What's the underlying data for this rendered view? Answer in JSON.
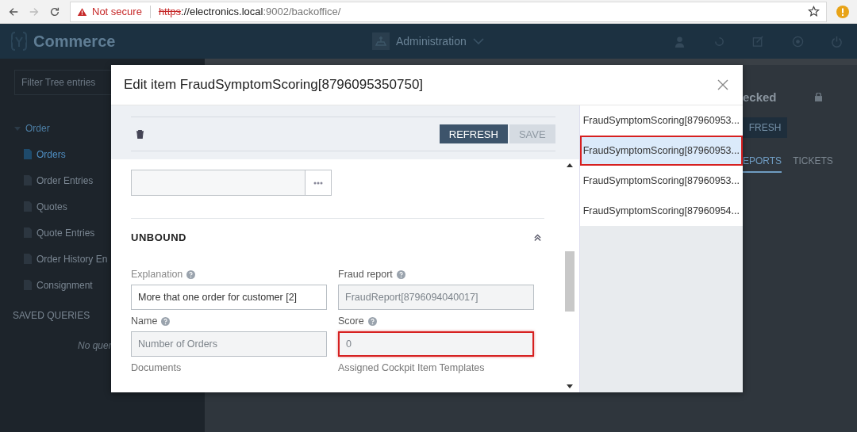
{
  "browser": {
    "security": "Not secure",
    "url_scheme": "https",
    "url_host": "://electronics.local",
    "url_rest": ":9002/backoffice/"
  },
  "header": {
    "logo": "Commerce",
    "perspective": "Administration"
  },
  "sidebar": {
    "filter_placeholder": "Filter Tree entries",
    "tree": [
      {
        "label": "Order",
        "expanded": true,
        "children": [
          {
            "label": "Orders",
            "selected": true
          },
          {
            "label": "Order Entries",
            "selected": false
          },
          {
            "label": "Quotes",
            "selected": false
          },
          {
            "label": "Quote Entries",
            "selected": false
          },
          {
            "label": "Order History En",
            "selected": false
          },
          {
            "label": "Consignment",
            "selected": false
          }
        ]
      }
    ],
    "saved_queries_title": "SAVED QUERIES",
    "saved_queries_empty": "No quer"
  },
  "background_panel": {
    "title": "ecked",
    "button": "FRESH",
    "tabs": [
      {
        "label": "EPORTS",
        "selected": true
      },
      {
        "label": "TICKETS",
        "selected": false
      }
    ]
  },
  "dialog": {
    "title": "Edit item FraudSymptomScoring[8796095350750]",
    "toolbar": {
      "buttons": [
        {
          "label": "REFRESH",
          "disabled": false
        },
        {
          "label": "SAVE",
          "disabled": true
        }
      ]
    },
    "section": {
      "title": "UNBOUND",
      "expanded": true
    },
    "fields": [
      {
        "label": "Explanation",
        "value": "More that one order for customer [2]",
        "disabled": false,
        "highlighted": false
      },
      {
        "label": "Fraud report",
        "value": "FraudReport[8796094040017]",
        "disabled": true,
        "highlighted": false
      },
      {
        "label": "Name",
        "value": "Number of Orders",
        "disabled": true,
        "highlighted": false
      },
      {
        "label": "Score",
        "value": "0",
        "disabled": true,
        "highlighted": true
      }
    ],
    "more_labels": [
      "Documents",
      "Assigned Cockpit Item Templates"
    ],
    "list": [
      {
        "label": "FraudSymptomScoring[87960953...",
        "selected": false,
        "highlighted": false
      },
      {
        "label": "FraudSymptomScoring[87960953...",
        "selected": true,
        "highlighted": true
      },
      {
        "label": "FraudSymptomScoring[87960953...",
        "selected": false,
        "highlighted": false
      },
      {
        "label": "FraudSymptomScoring[87960954...",
        "selected": false,
        "highlighted": false
      }
    ]
  }
}
